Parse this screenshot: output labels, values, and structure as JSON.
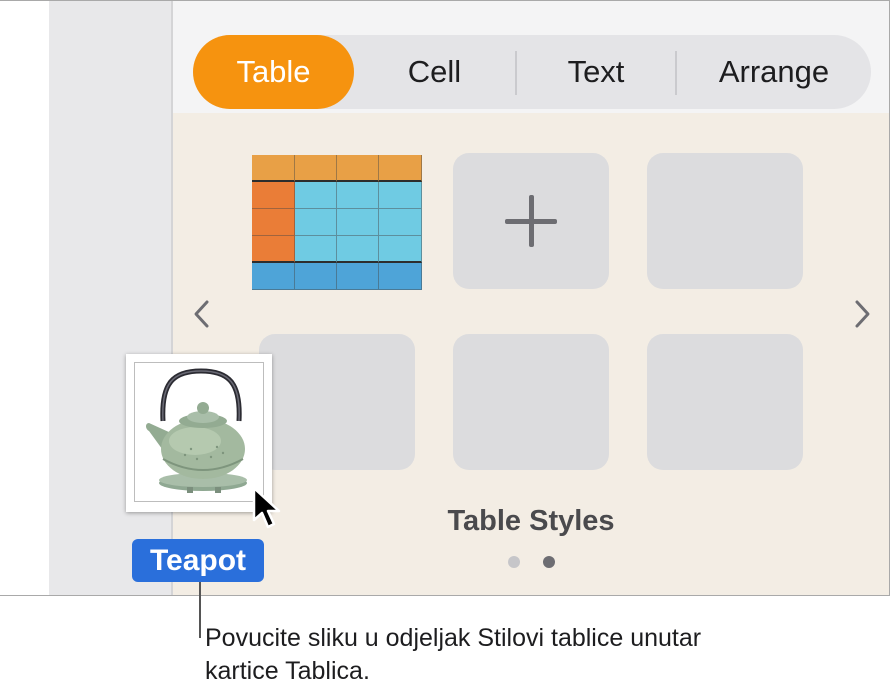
{
  "tabs": [
    {
      "label": "Table",
      "active": true
    },
    {
      "label": "Cell",
      "active": false
    },
    {
      "label": "Text",
      "active": false
    },
    {
      "label": "Arrange",
      "active": false
    }
  ],
  "panel": {
    "section_title": "Table Styles",
    "page_count": 2,
    "current_page": 2,
    "icons": {
      "prev": "chevron-left-icon",
      "next": "chevron-right-icon",
      "add": "plus-icon"
    }
  },
  "drag_item": {
    "label": "Teapot",
    "image": "teapot-photo",
    "cursor": "pointer-cursor-icon"
  },
  "callout": {
    "text": "Povucite sliku u odjeljak Stilovi tablice unutar kartice Tablica."
  },
  "colors": {
    "accent": "#f6930f",
    "label_blue": "#2a6fdb",
    "panel_bg": "#f3ede4",
    "table_header": "#e8a046",
    "table_first_col": "#ea7d37",
    "table_body": "#6fcbe3",
    "table_footer": "#4ea4d8"
  }
}
